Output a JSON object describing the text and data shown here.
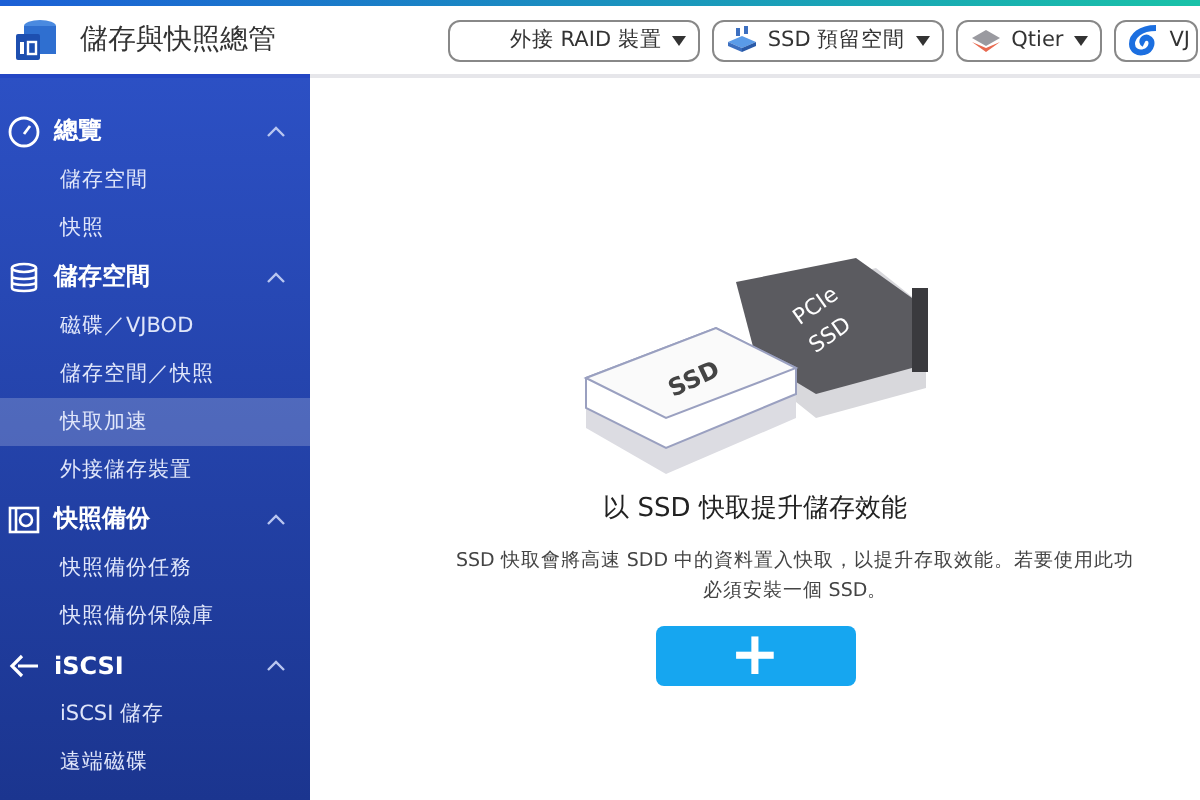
{
  "app": {
    "title": "儲存與快照總管"
  },
  "toolbar": [
    {
      "label": "外接 RAID 裝置",
      "kind": "plain"
    },
    {
      "label": "SSD 預留空間",
      "kind": "ssd"
    },
    {
      "label": "Qtier",
      "kind": "layers"
    },
    {
      "label": "VJ",
      "kind": "cloud"
    }
  ],
  "sidebar": {
    "sections": [
      {
        "title": "總覽",
        "kind": "gauge",
        "expanded": true,
        "items": [
          {
            "label": "儲存空間",
            "selected": false
          },
          {
            "label": "快照",
            "selected": false
          }
        ]
      },
      {
        "title": "儲存空間",
        "kind": "database",
        "expanded": true,
        "items": [
          {
            "label": "磁碟／VJBOD",
            "selected": false
          },
          {
            "label": "儲存空間／快照",
            "selected": false
          },
          {
            "label": "快取加速",
            "selected": true
          },
          {
            "label": "外接儲存裝置",
            "selected": false
          }
        ]
      },
      {
        "title": "快照備份",
        "kind": "camera",
        "expanded": true,
        "items": [
          {
            "label": "快照備份任務",
            "selected": false
          },
          {
            "label": "快照備份保險庫",
            "selected": false
          }
        ]
      },
      {
        "title": "iSCSI",
        "kind": "iscsi",
        "expanded": true,
        "items": [
          {
            "label": "iSCSI 儲存",
            "selected": false
          },
          {
            "label": "遠端磁碟",
            "selected": false
          }
        ]
      }
    ]
  },
  "main": {
    "illustration_labels": [
      "SSD",
      "PCIe",
      "SSD"
    ],
    "heading": "以 SSD 快取提升儲存效能",
    "description": [
      "SSD 快取會將高速 SDD 中的資料置入快取，以提升存取效能。若要使用此功",
      "必須安裝一個 SSD。"
    ],
    "add_button": "+"
  }
}
